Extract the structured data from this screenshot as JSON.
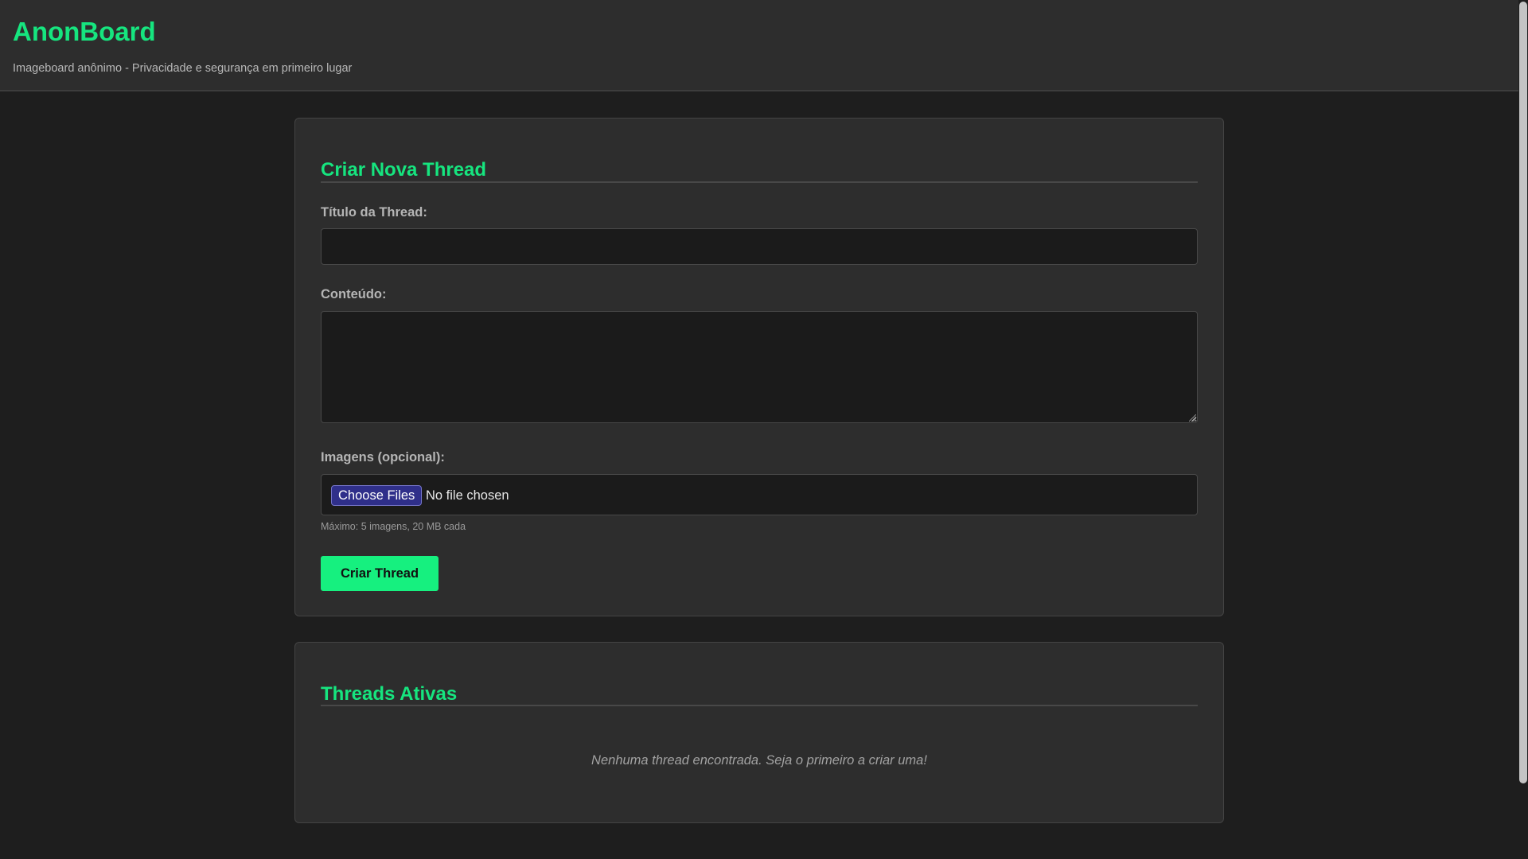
{
  "header": {
    "title": "AnonBoard",
    "tagline": "Imageboard anônimo - Privacidade e segurança em primeiro lugar"
  },
  "create_thread": {
    "heading": "Criar Nova Thread",
    "title_label": "Título da Thread:",
    "title_value": "",
    "content_label": "Conteúdo:",
    "content_value": "",
    "images_label": "Imagens (opcional):",
    "file_button_label": "Choose Files",
    "file_status": "No file chosen",
    "file_hint": "Máximo: 5 imagens, 20 MB cada",
    "submit_label": "Criar Thread"
  },
  "threads": {
    "heading": "Threads Ativas",
    "empty_message": "Nenhuma thread encontrada. Seja o primeiro a criar uma!",
    "items": []
  },
  "colors": {
    "accent": "#16e57f",
    "button": "#16f07f",
    "background": "#1e1e1e",
    "panel": "#2d2d2d",
    "file_button": "#2f2f8a"
  }
}
